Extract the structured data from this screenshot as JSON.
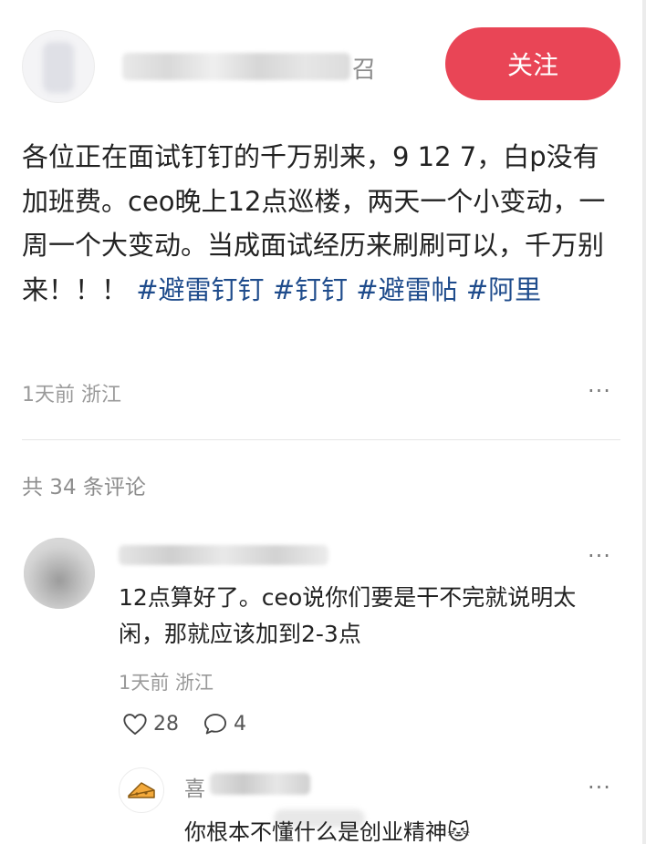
{
  "post": {
    "author_tail": "召",
    "follow_label": "关注",
    "content_text": "各位正在面试钉钉的千万别来，9 12 7，白p没有加班费。ceo晚上12点巡楼，两天一个小变动，一周一个大变动。当成面试经历来刷刷可以，千万别来！！！",
    "hashtags": [
      "#避雷钉钉",
      "#钉钉",
      "#避雷帖",
      "#阿里"
    ],
    "meta": "1天前 浙江",
    "more_label": "···"
  },
  "comments_header": "共 34 条评论",
  "comment": {
    "text": "12点算好了。ceo说你们要是干不完就说明太闲，那就应该加到2-3点",
    "meta": "1天前 浙江",
    "likes": "28",
    "replies": "4",
    "more_label": "···"
  },
  "reply": {
    "name_start": "喜",
    "text": "你根本不懂什么是创业精神",
    "emoji": "🐱",
    "more_label": "···"
  },
  "colors": {
    "follow_button": "#e94556",
    "hashtag": "#1f4c8c",
    "meta_gray": "#9a9a9a"
  },
  "icons": [
    "heart-icon",
    "comment-bubble-icon",
    "more-icon"
  ]
}
